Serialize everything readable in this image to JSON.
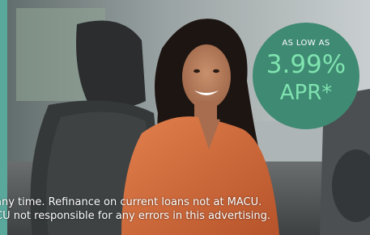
{
  "badge": {
    "top_text": "AS LOW AS",
    "rate": "3.99%",
    "suffix": "APR*"
  },
  "disclaimer": {
    "line1": "any time. Refinance on current loans not at MACU.",
    "line2": "CU not responsible for any errors in this advertising."
  },
  "colors": {
    "badge_fill": "#3f8a72",
    "rate_text": "#7fe3b0",
    "accent_strip": "#5aa89c"
  }
}
